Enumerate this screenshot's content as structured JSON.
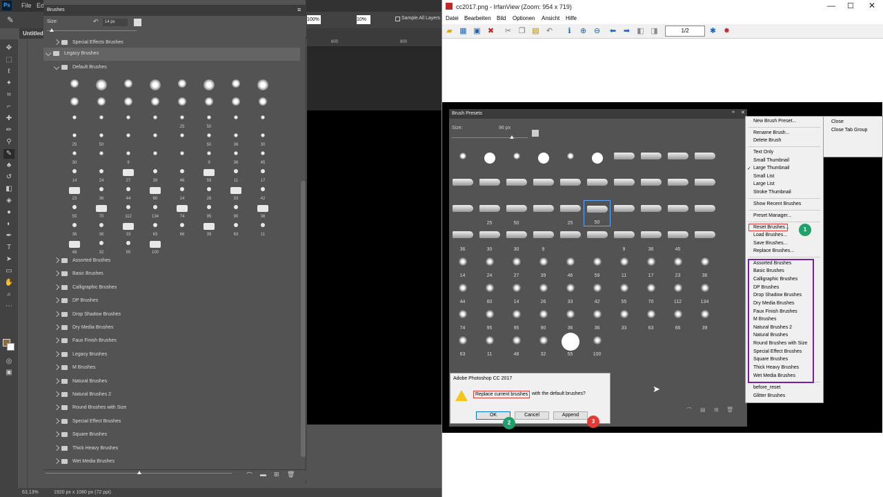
{
  "ps": {
    "menu": [
      "File",
      "Edi"
    ],
    "doc_tab": "Untitled",
    "zoom_values": [
      "100%",
      "10%"
    ],
    "sample_label": "Sample All Layers",
    "ruler": [
      "600",
      "800"
    ],
    "status_zoom": "63,13%",
    "status_doc": "1920 px x 1080 px (72 ppi)"
  },
  "brushes_panel": {
    "title": "Brushes",
    "size_label": "Size:",
    "size_value": "14 px",
    "groups_top": [
      {
        "label": "Special Effects Brushes"
      },
      {
        "label": "Legacy Brushes"
      },
      {
        "label": "Default Brushes"
      }
    ],
    "brush_numbers": [
      "",
      "",
      "",
      "",
      "",
      "",
      "",
      "",
      "",
      "",
      "",
      "",
      "",
      "",
      "",
      "",
      "",
      "",
      "",
      "",
      "25",
      "50",
      "",
      "",
      "25",
      "50",
      "",
      "",
      "",
      "50",
      "36",
      "30",
      "30",
      "",
      "9",
      "",
      "",
      "9",
      "36",
      "45",
      "14",
      "24",
      "27",
      "39",
      "46",
      "59",
      "11",
      "17",
      "23",
      "36",
      "44",
      "60",
      "14",
      "26",
      "33",
      "42",
      "55",
      "70",
      "112",
      "134",
      "74",
      "95",
      "90",
      "36",
      "36",
      "36",
      "33",
      "63",
      "66",
      "39",
      "63",
      "11",
      "48",
      "32",
      "55",
      "100"
    ],
    "groups_bottom": [
      "Assorted Brushes",
      "Basic Brushes",
      "Calligraphic Brushes",
      "DP Brushes",
      "Drop Shadow Brushes",
      "Dry Media Brushes",
      "Faux Finish Brushes",
      "Legacy Brushes",
      "M Brushes",
      "Natural Brushes",
      "Natural Brushes 2",
      "Round Brushes with Size",
      "Special Effect Brushes",
      "Square Brushes",
      "Thick Heavy Brushes",
      "Wet Media Brushes"
    ]
  },
  "irfan": {
    "title": "cc2017.png - IrfanView (Zoom: 954 x 719)",
    "menu": [
      "Datei",
      "Bearbeiten",
      "Bild",
      "Optionen",
      "Ansicht",
      "Hilfe"
    ],
    "page": "1/2",
    "presets": {
      "title": "Brush Presets",
      "size_label": "Size:",
      "size_value": "96 px",
      "numbers": [
        "",
        "",
        "",
        "",
        "",
        "",
        "",
        "",
        "",
        "",
        "",
        "",
        "",
        "",
        "",
        "",
        "",
        "",
        "",
        "",
        "",
        "25",
        "50",
        "",
        "25",
        "50",
        "",
        "",
        "",
        "",
        "36",
        "30",
        "30",
        "9",
        "",
        "",
        "9",
        "36",
        "45",
        "",
        "14",
        "24",
        "27",
        "39",
        "46",
        "59",
        "11",
        "17",
        "23",
        "36",
        "44",
        "60",
        "14",
        "26",
        "33",
        "42",
        "55",
        "70",
        "112",
        "134",
        "74",
        "95",
        "95",
        "90",
        "36",
        "36",
        "33",
        "63",
        "66",
        "39",
        "63",
        "11",
        "48",
        "32",
        "55",
        "100",
        "",
        "",
        "",
        ""
      ]
    },
    "menu_items": [
      "New Brush Preset...",
      "Rename Brush...",
      "Delete Brush",
      "Text Only",
      "Small Thumbnail",
      "Large Thumbnail",
      "Small List",
      "Large List",
      "Stroke Thumbnail",
      "Show Recent Brushes",
      "Preset Manager...",
      "Reset Brushes...",
      "Load Brushes...",
      "Save Brushes...",
      "Replace Brushes...",
      "Assorted Brushes",
      "Basic Brushes",
      "Calligraphic Brushes",
      "DP Brushes",
      "Drop Shadow Brushes",
      "Dry Media Brushes",
      "Faux Finish Brushes",
      "M Brushes",
      "Natural Brushes 2",
      "Natural Brushes",
      "Round Brushes with Size",
      "Special Effect Brushes",
      "Square Brushes",
      "Thick Heavy Brushes",
      "Wet Media Brushes",
      "before_reset",
      "Glitter Brushes"
    ],
    "submenu": [
      "Close",
      "Close Tab Group"
    ],
    "dialog": {
      "title": "Adobe Photoshop CC 2017",
      "message_highlight": "Replace current brushes",
      "message_rest": " with the default brushes?",
      "ok": "OK",
      "cancel": "Cancel",
      "append": "Append"
    },
    "badges": [
      "1",
      "2",
      "3"
    ]
  },
  "colors": {
    "ps_dark": "#535353",
    "accent_red": "#e53935",
    "accent_green": "#20a06a",
    "accent_purple": "#7a1fa2"
  }
}
